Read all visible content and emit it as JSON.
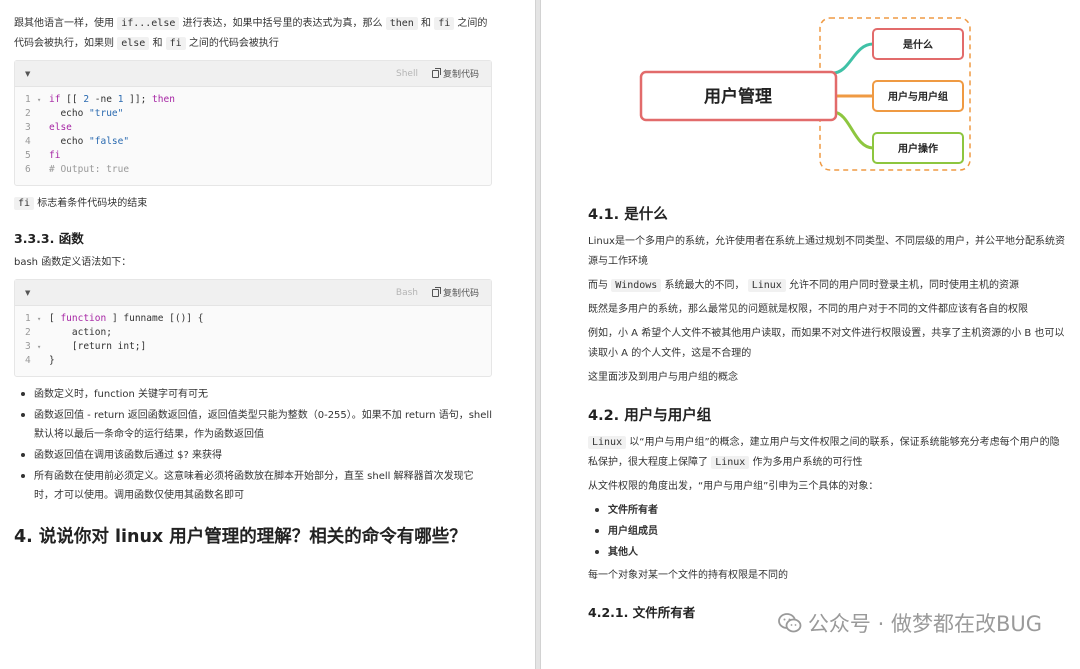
{
  "left": {
    "intro": {
      "t1": "跟其他语言一样，使用 ",
      "c1": "if...else",
      "t2": " 进行表达，如果中括号里的表达式为真，那么 ",
      "c2": "then",
      "t3": " 和 ",
      "c3": "fi",
      "t4": " 之间的代码会被执行，如果则 ",
      "c4": "else",
      "t5": " 和 ",
      "c5": "fi",
      "t6": " 之间的代码会被执行"
    },
    "code1": {
      "lang": "Shell",
      "copy": "复制代码",
      "lines": [
        {
          "n": "1",
          "fold": "▾",
          "a": "if [[ 2 -ne 1 ]]; ",
          "b": "then",
          "c": ""
        },
        {
          "n": "2",
          "fold": "",
          "a": "  echo ",
          "b": "",
          "c": "\"true\""
        },
        {
          "n": "3",
          "fold": "",
          "a": "",
          "b": "else",
          "c": ""
        },
        {
          "n": "4",
          "fold": "",
          "a": "  echo ",
          "b": "",
          "c": "\"false\""
        },
        {
          "n": "5",
          "fold": "",
          "a": "",
          "b": "fi",
          "c": ""
        },
        {
          "n": "6",
          "fold": "",
          "a": "",
          "b": "",
          "c": "",
          "d": "# Output: true"
        }
      ]
    },
    "fi_note": {
      "code": "fi",
      "text": " 标志着条件代码块的结束"
    },
    "h_func": "3.3.3. 函数",
    "func_intro": "bash 函数定义语法如下：",
    "code2": {
      "lang": "Bash",
      "copy": "复制代码",
      "lines": [
        {
          "n": "1",
          "fold": "▾",
          "a": "[ ",
          "b": "function",
          "c": " ] funname [()] {"
        },
        {
          "n": "2",
          "fold": "",
          "a": "    action;",
          "b": "",
          "c": ""
        },
        {
          "n": "3",
          "fold": "▾",
          "a": "    [return int;]",
          "b": "",
          "c": ""
        },
        {
          "n": "4",
          "fold": "",
          "a": "}",
          "b": "",
          "c": ""
        }
      ]
    },
    "bullets": [
      "函数定义时，function 关键字可有可无",
      "函数返回值 - return 返回函数返回值，返回值类型只能为整数（0-255）。如果不加 return 语句，shell 默认将以最后一条命令的运行结果，作为函数返回值",
      "函数返回值在调用该函数后通过 $? 来获得",
      "所有函数在使用前必须定义。这意味着必须将函数放在脚本开始部分，直至 shell 解释器首次发现它时，才可以使用。调用函数仅使用其函数名即可"
    ],
    "h4": "4. 说说你对 linux 用户管理的理解？相关的命令有哪些？"
  },
  "right": {
    "mindmap": {
      "center": "用户管理",
      "nodes": [
        "是什么",
        "用户与用户组",
        "用户操作"
      ]
    },
    "h41": "4.1. 是什么",
    "p1": "Linux是一个多用户的系统，允许使用者在系统上通过规划不同类型、不同层级的用户，并公平地分配系统资源与工作环境",
    "p2": {
      "t1": "而与 ",
      "c1": "Windows",
      "t2": " 系统最大的不同， ",
      "c2": "Linux",
      "t3": " 允许不同的用户同时登录主机，同时使用主机的资源"
    },
    "p3": "既然是多用户的系统，那么最常见的问题就是权限，不同的用户对于不同的文件都应该有各自的权限",
    "p4": "例如，小 A 希望个人文件不被其他用户读取，而如果不对文件进行权限设置，共享了主机资源的小 B 也可以读取小 A 的个人文件，这是不合理的",
    "p5": "这里面涉及到用户与用户组的概念",
    "h42": "4.2. 用户与用户组",
    "p6": {
      "c1": "Linux",
      "t1": " 以“用户与用户组”的概念，建立用户与文件权限之间的联系，保证系统能够充分考虑每个用户的隐私保护，很大程度上保障了 ",
      "c2": "Linux",
      "t2": " 作为多用户系统的可行性"
    },
    "p7": "从文件权限的角度出发，“用户与用户组”引申为三个具体的对象：",
    "bullets": [
      "文件所有者",
      "用户组成员",
      "其他人"
    ],
    "p8": "每一个对象对某一个文件的持有权限是不同的",
    "h421": "4.2.1. 文件所有者"
  },
  "watermark": "公众号 · 做梦都在改BUG",
  "colors": {
    "center_border": "#e26b6b",
    "node_border": "#ef9a43",
    "line_green": "#8dc63f",
    "line_teal": "#3fc1a6"
  }
}
